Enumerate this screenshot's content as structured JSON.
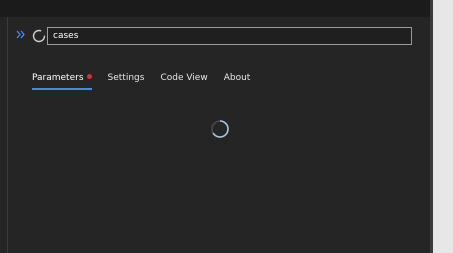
{
  "search": {
    "value": "cases",
    "placeholder": ""
  },
  "tabs": [
    {
      "label": "Parameters",
      "active": true,
      "has_error_dot": true
    },
    {
      "label": "Settings",
      "active": false
    },
    {
      "label": "Code View",
      "active": false
    },
    {
      "label": "About",
      "active": false
    }
  ],
  "icons": {
    "expand": "double-chevron-right-icon",
    "loading": "loading-spinner-icon"
  },
  "colors": {
    "accent": "#3f8fe6",
    "error_dot": "#d13438",
    "background": "#252525"
  }
}
